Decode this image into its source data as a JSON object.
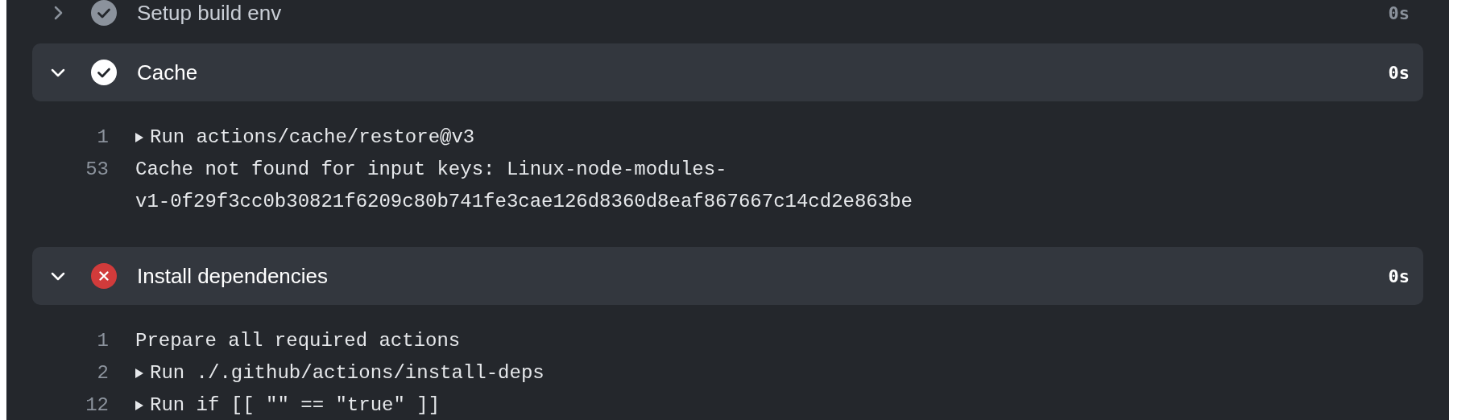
{
  "steps": [
    {
      "name": "Setup build env",
      "kind": "success",
      "expanded": false,
      "duration": "0s"
    },
    {
      "name": "Cache",
      "kind": "success",
      "expanded": true,
      "duration": "0s",
      "lines": [
        {
          "number": "1",
          "collapsible": true,
          "text_lines": [
            "Run actions/cache/restore@v3"
          ]
        },
        {
          "number": "53",
          "collapsible": false,
          "text_lines": [
            "Cache not found for input keys: Linux-node-modules-",
            "v1-0f29f3cc0b30821f6209c80b741fe3cae126d8360d8eaf867667c14cd2e863be"
          ]
        }
      ]
    },
    {
      "name": "Install dependencies",
      "kind": "failure",
      "expanded": true,
      "duration": "0s",
      "lines": [
        {
          "number": "1",
          "collapsible": false,
          "text_lines": [
            "Prepare all required actions"
          ]
        },
        {
          "number": "2",
          "collapsible": true,
          "text_lines": [
            "Run ./.github/actions/install-deps"
          ]
        },
        {
          "number": "12",
          "collapsible": true,
          "text_lines": [
            "Run if [[ \"\" == \"true\" ]]"
          ]
        }
      ]
    }
  ]
}
